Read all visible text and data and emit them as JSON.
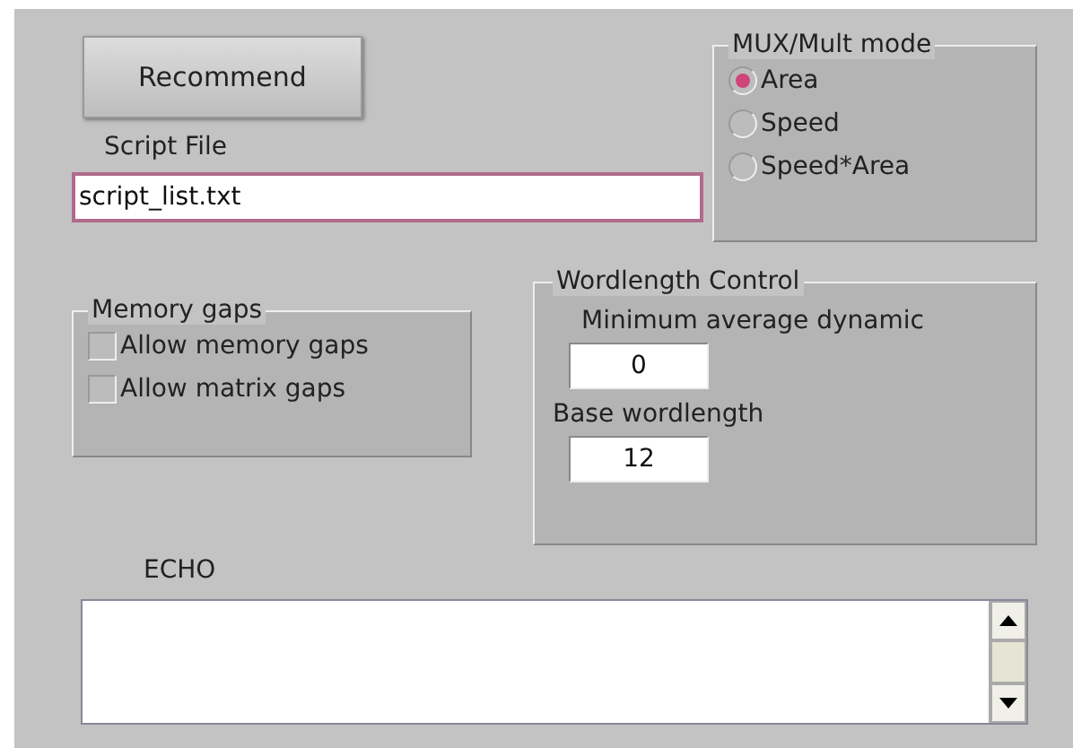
{
  "recommend_button": {
    "label": "Recommend"
  },
  "script_file": {
    "label": "Script File",
    "value": "script_list.txt"
  },
  "mux_mult_mode": {
    "title": "MUX/Mult mode",
    "options": [
      {
        "label": "Area",
        "selected": true
      },
      {
        "label": "Speed",
        "selected": false
      },
      {
        "label": "Speed*Area",
        "selected": false
      }
    ]
  },
  "memory_gaps": {
    "title": "Memory gaps",
    "options": [
      {
        "label": "Allow memory gaps",
        "checked": false
      },
      {
        "label": "Allow matrix gaps",
        "checked": false
      }
    ]
  },
  "wordlength_control": {
    "title": "Wordlength Control",
    "fields": [
      {
        "label": "Minimum average dynamic",
        "value": "0"
      },
      {
        "label": "Base wordlength",
        "value": "12"
      }
    ]
  },
  "echo": {
    "label": "ECHO"
  }
}
